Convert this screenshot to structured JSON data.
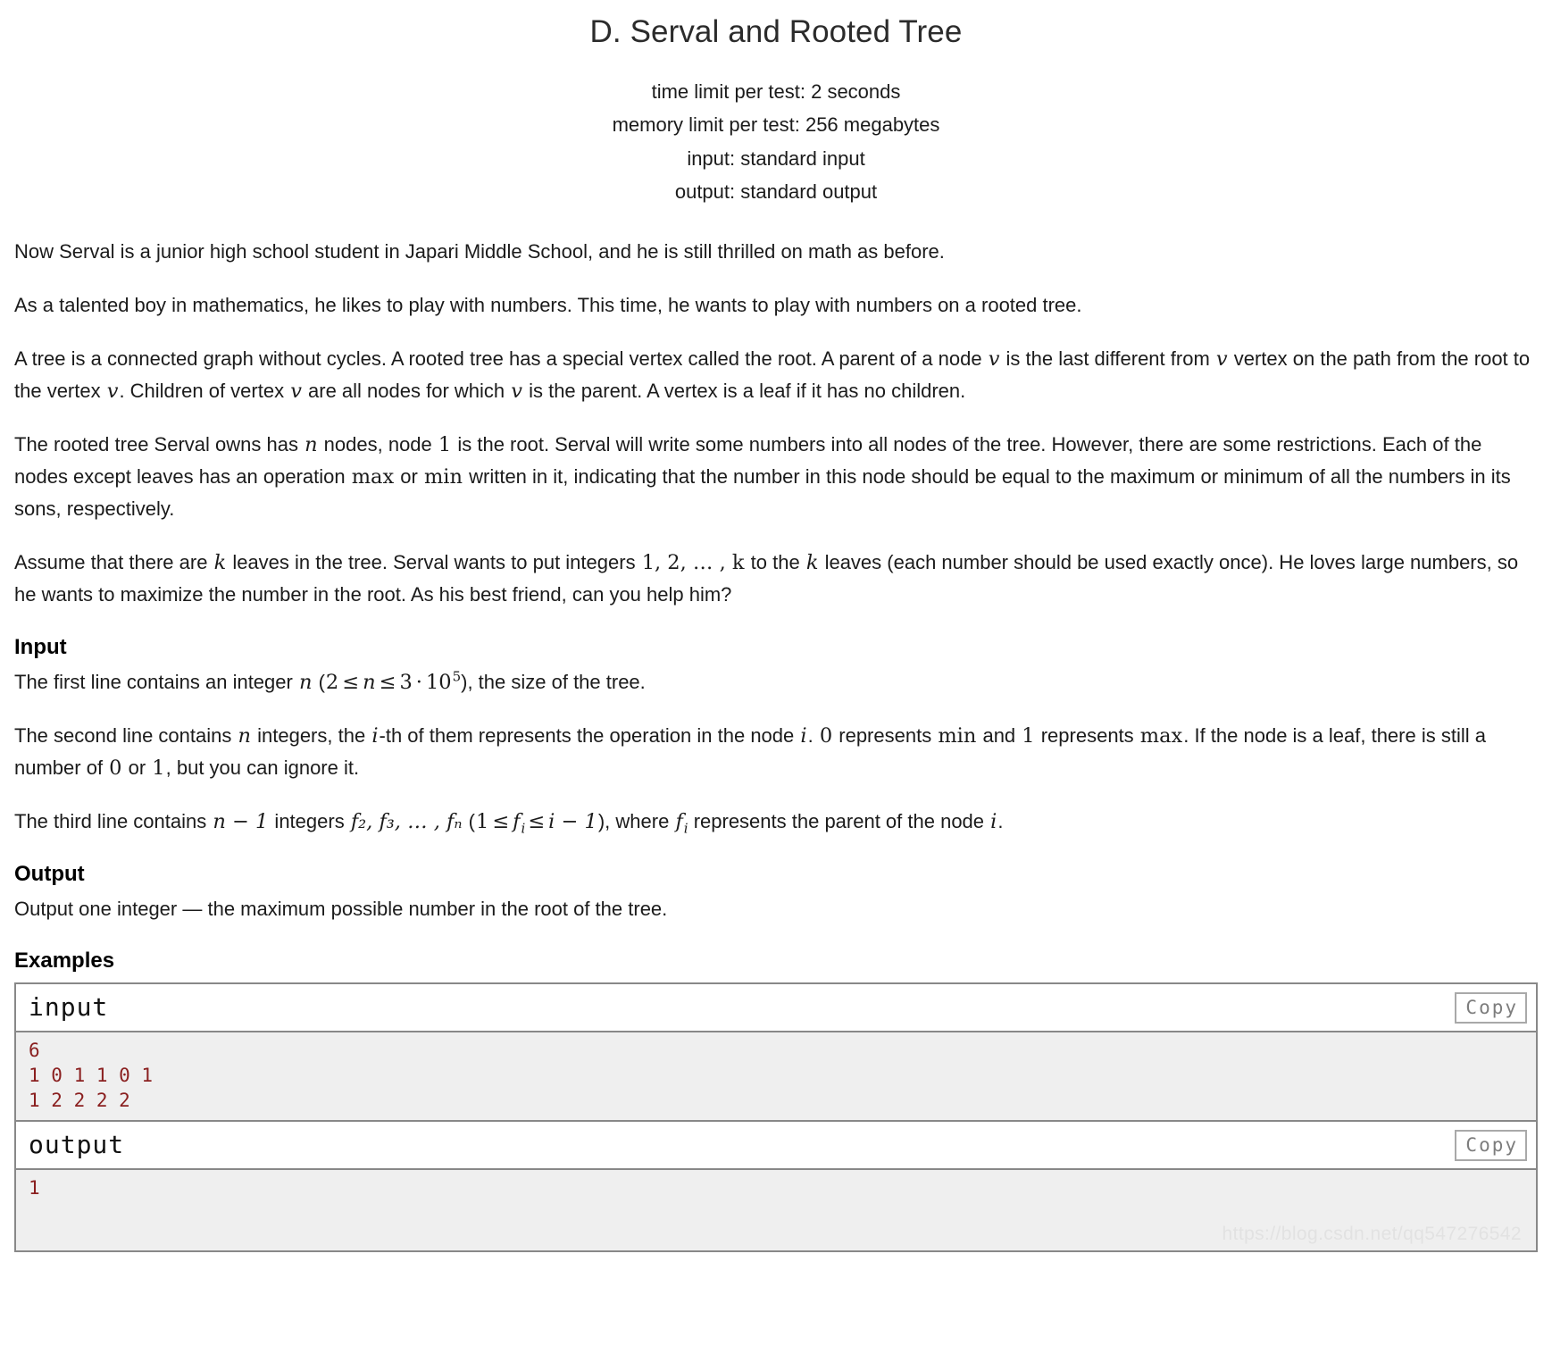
{
  "header": {
    "title": "D. Serval and Rooted Tree",
    "time_limit": "time limit per test: 2 seconds",
    "memory_limit": "memory limit per test: 256 megabytes",
    "input_spec": "input: standard input",
    "output_spec": "output: standard output"
  },
  "statement": {
    "p1": "Now Serval is a junior high school student in Japari Middle School, and he is still thrilled on math as before.",
    "p2": "As a talented boy in mathematics, he likes to play with numbers. This time, he wants to play with numbers on a rooted tree.",
    "p3_a": "A tree is a connected graph without cycles. A rooted tree has a special vertex called the root. A parent of a node ",
    "p3_v1": "v",
    "p3_b": " is the last different from ",
    "p3_v2": "v",
    "p3_c": " vertex on the path from the root to the vertex ",
    "p3_v3": "v",
    "p3_d": ". Children of vertex ",
    "p3_v4": "v",
    "p3_e": " are all nodes for which ",
    "p3_v5": "v",
    "p3_f": " is the parent. A vertex is a leaf if it has no children.",
    "p4_a": "The rooted tree Serval owns has ",
    "p4_n": "n",
    "p4_b": " nodes, node ",
    "p4_one": "1",
    "p4_c": " is the root. Serval will write some numbers into all nodes of the tree. However, there are some restrictions. Each of the nodes except leaves has an operation ",
    "p4_max": "max",
    "p4_d": " or ",
    "p4_min": "min",
    "p4_e": " written in it, indicating that the number in this node should be equal to the maximum or minimum of all the numbers in its sons, respectively.",
    "p5_a": "Assume that there are ",
    "p5_k1": "k",
    "p5_b": " leaves in the tree. Serval wants to put integers ",
    "p5_seq": "1, 2, … , k",
    "p5_c": " to the ",
    "p5_k2": "k",
    "p5_d": " leaves (each number should be used exactly once). He loves large numbers, so he wants to maximize the number in the root. As his best friend, can you help him?"
  },
  "input_section": {
    "heading": "Input",
    "l1_a": "The first line contains an integer ",
    "l1_n": "n",
    "l1_open": " (",
    "l1_two": "2",
    "l1_le1": "≤",
    "l1_n2": "n",
    "l1_le2": "≤",
    "l1_three": "3",
    "l1_dot": "·",
    "l1_ten": "10",
    "l1_exp": "5",
    "l1_close": "), the size of the tree.",
    "l2_a": "The second line contains ",
    "l2_n": "n",
    "l2_b": " integers, the ",
    "l2_i": "i",
    "l2_c": "-th of them represents the operation in the node ",
    "l2_i2": "i",
    "l2_d": ". ",
    "l2_zero": "0",
    "l2_e": " represents ",
    "l2_min": "min",
    "l2_f": " and ",
    "l2_one": "1",
    "l2_g": " represents ",
    "l2_max": "max",
    "l2_h": ". If the node is a leaf, there is still a number of ",
    "l2_zero2": "0",
    "l2_i3": " or ",
    "l2_one2": "1",
    "l2_j": ", but you can ignore it.",
    "l3_a": "The third line contains ",
    "l3_nm1": "n − 1",
    "l3_b": " integers ",
    "l3_flist": "f₂, f₃, … , fₙ",
    "l3_c": " (",
    "l3_one": "1",
    "l3_le1": "≤",
    "l3_fi": "f",
    "l3_fi_sub": "i",
    "l3_le2": "≤",
    "l3_im1": "i − 1",
    "l3_d": "), where ",
    "l3_fi2": "f",
    "l3_fi2_sub": "i",
    "l3_e": " represents the parent of the node ",
    "l3_i": "i",
    "l3_f": "."
  },
  "output_section": {
    "heading": "Output",
    "text": "Output one integer — the maximum possible number in the root of the tree."
  },
  "examples": {
    "heading": "Examples",
    "copy_label": "Copy",
    "input_label": "input",
    "output_label": "output",
    "input_data": "6\n1 0 1 1 0 1\n1 2 2 2 2",
    "output_data": "1"
  },
  "watermark": "https://blog.csdn.net/qq547276542",
  "colors": {
    "sample_text": "#8a1f1f",
    "sample_bg": "#efefef",
    "border": "#888888",
    "copy_text": "#7d7d7d"
  }
}
